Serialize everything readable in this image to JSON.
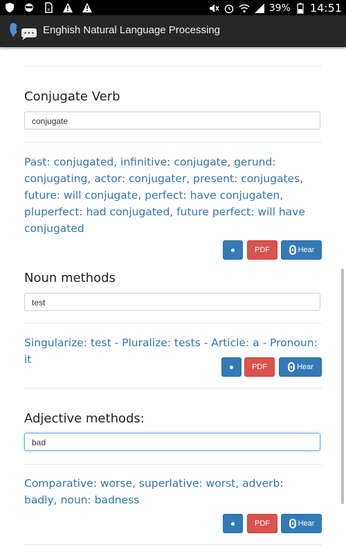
{
  "status_bar": {
    "time": "14:51",
    "battery": "39%",
    "icons_left": [
      "shield-icon",
      "ninja-icon",
      "sim-icon",
      "warning-icon",
      "warning-icon"
    ],
    "icons_right": [
      "mute-icon",
      "alarm-icon",
      "wifi-icon",
      "signal-icon",
      "battery-icon"
    ]
  },
  "app_bar": {
    "title": "Enghish Natural Language Processing"
  },
  "sections": [
    {
      "title": "Conjugate Verb",
      "input_value": "conjugate",
      "result": "Past: conjugated, infinitive: conjugate, gerund: conjugating, actor: conjugater, present: conjugates, future: will conjugate, perfect: have conjugaten, pluperfect: had conjugated, future perfect: will have conjugated"
    },
    {
      "title": "Noun methods",
      "input_value": "test",
      "result": "Singularize: test - Pluralize: tests - Article: a - Pronoun: it"
    },
    {
      "title": "Adjective methods:",
      "input_value": "bad",
      "result": "Comparative: worse, superlative: worst, adverb: badly, noun: badness"
    }
  ],
  "buttons": {
    "pdf": "PDF",
    "hear": "Hear"
  },
  "colors": {
    "accent": "#337ab7",
    "danger": "#d9534f",
    "result_text": "#3275b0"
  }
}
